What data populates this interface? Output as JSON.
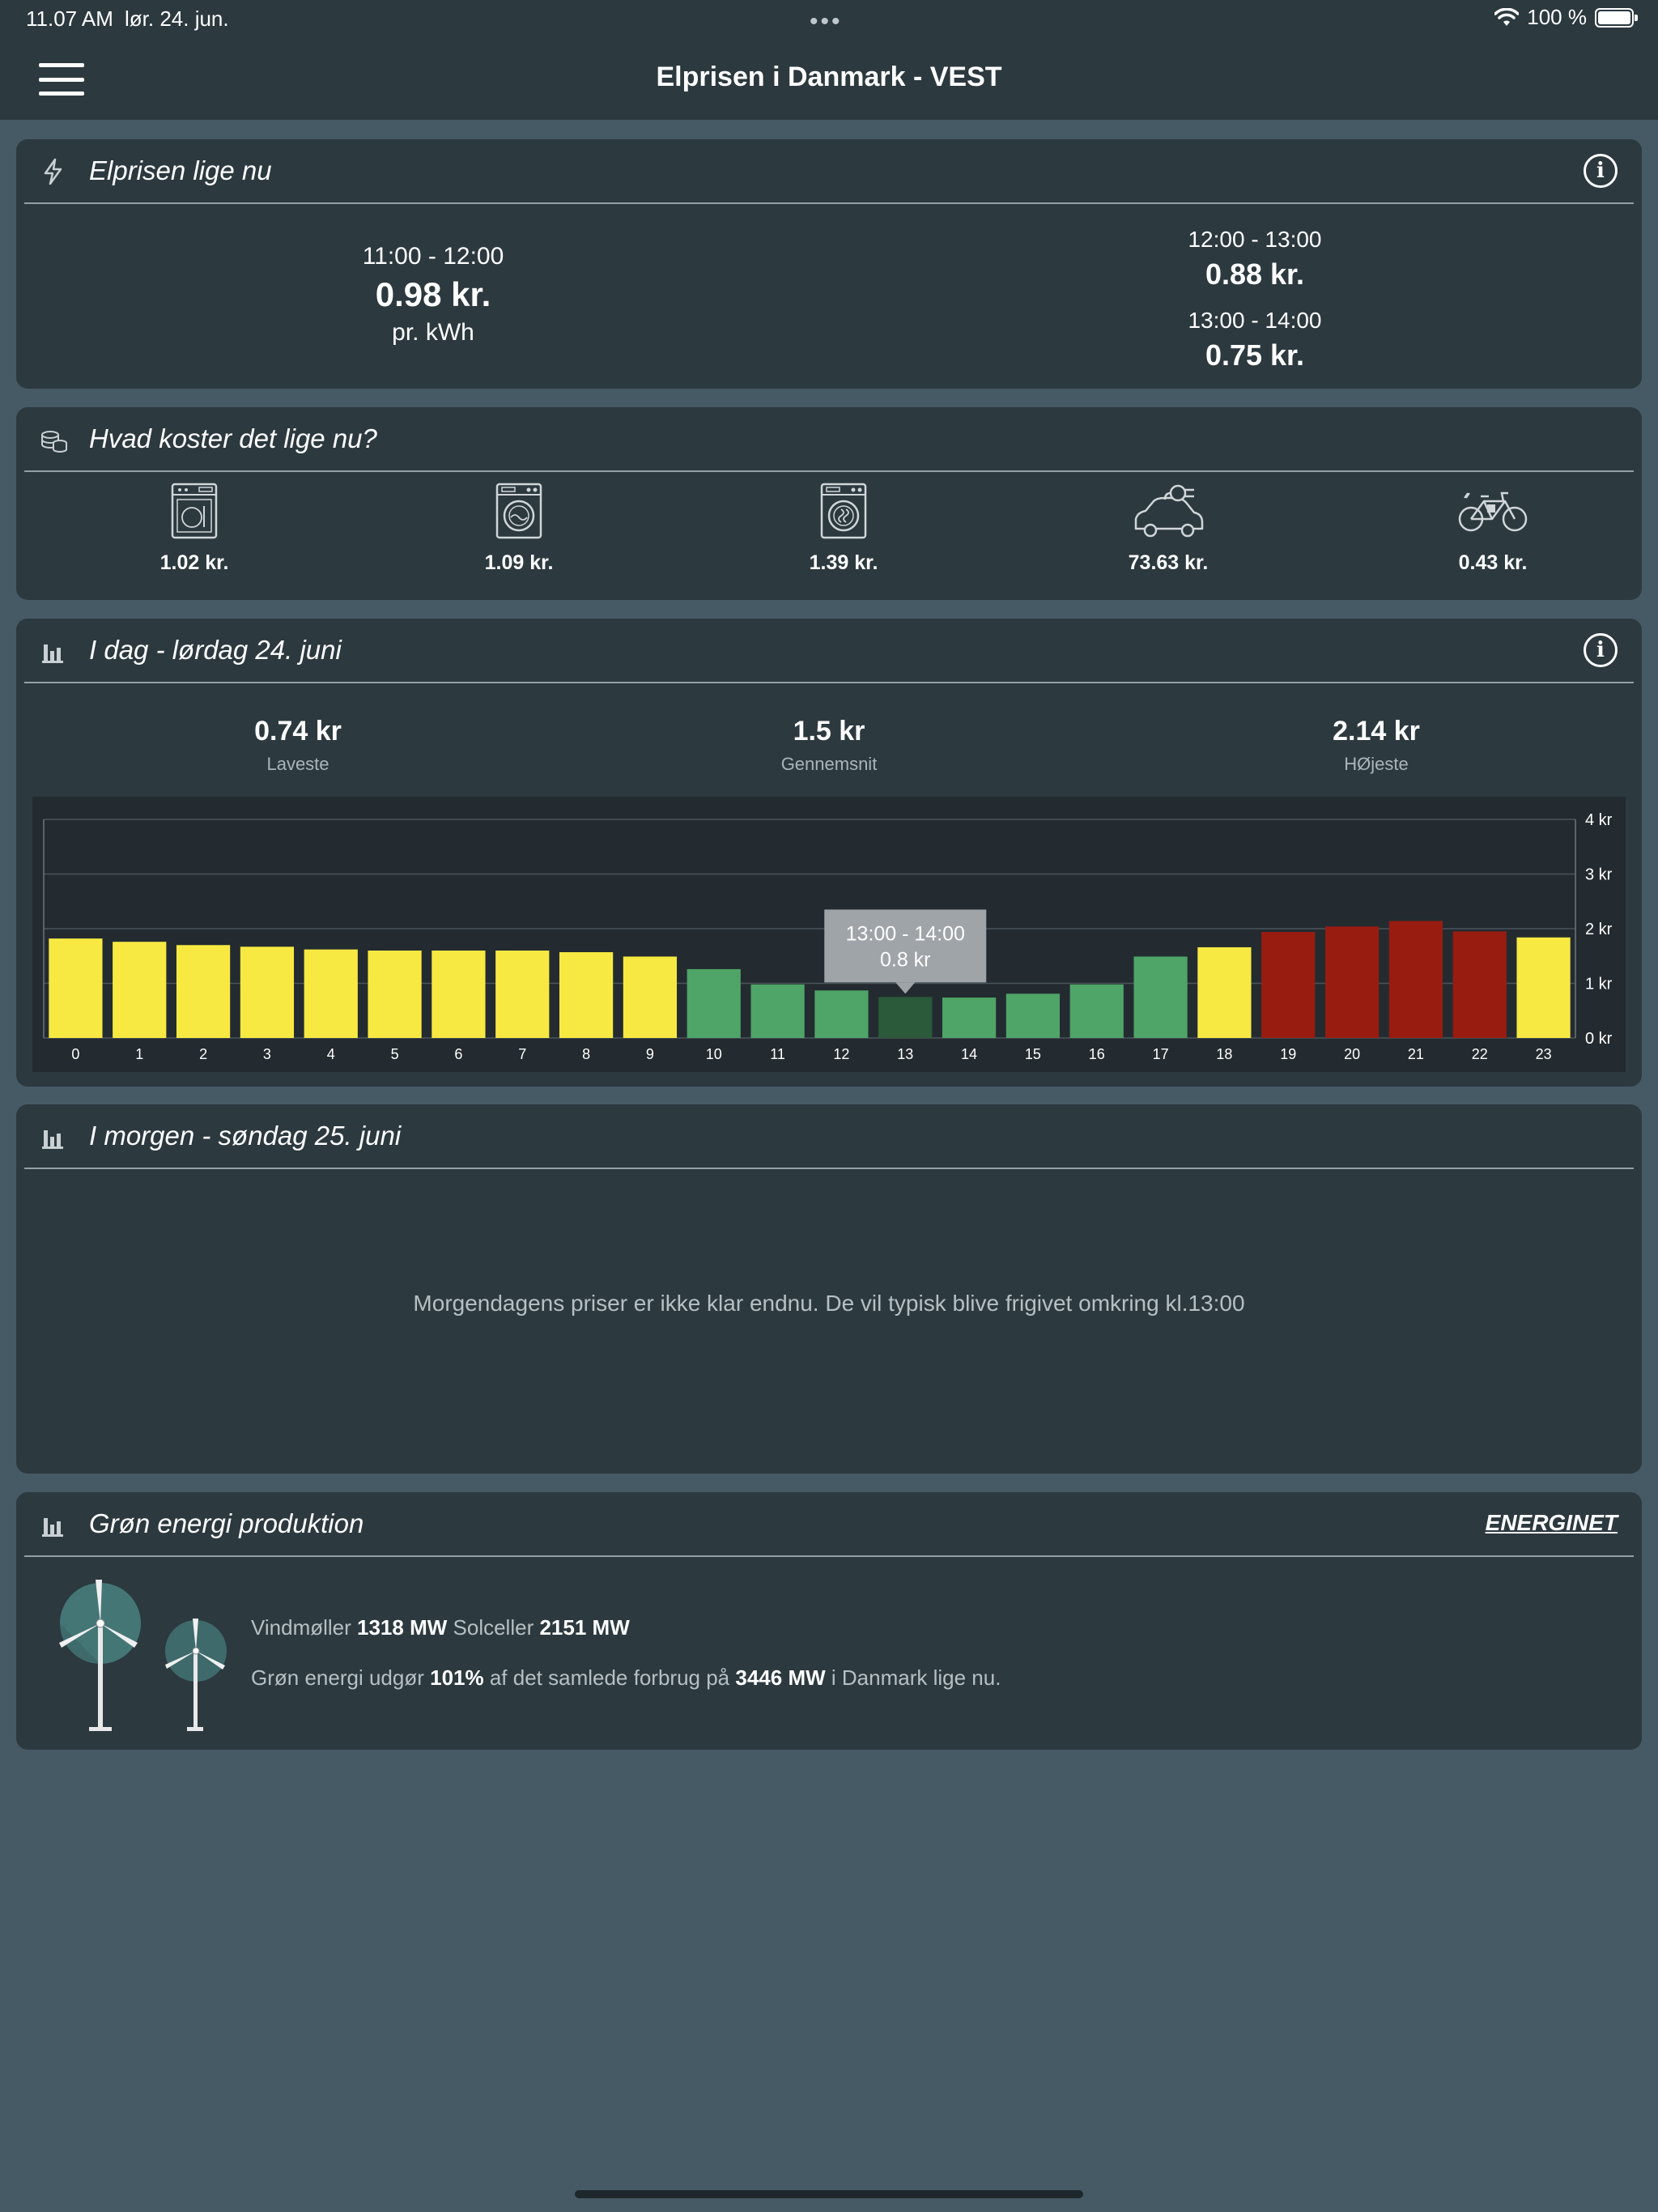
{
  "status_bar": {
    "time": "11.07 AM",
    "date": "lør. 24. jun.",
    "battery": "100 %"
  },
  "header": {
    "title": "Elprisen i Danmark - VEST"
  },
  "price_now": {
    "title": "Elprisen lige nu",
    "current": {
      "range": "11:00 - 12:00",
      "price": "0.98 kr.",
      "unit": "pr. kWh"
    },
    "next": [
      {
        "range": "12:00 - 13:00",
        "price": "0.88 kr."
      },
      {
        "range": "13:00 - 14:00",
        "price": "0.75 kr."
      }
    ]
  },
  "cost_now": {
    "title": "Hvad koster det lige nu?",
    "items": [
      {
        "icon": "dishwasher-icon",
        "price": "1.02 kr."
      },
      {
        "icon": "washing-machine-icon",
        "price": "1.09 kr."
      },
      {
        "icon": "dryer-icon",
        "price": "1.39 kr."
      },
      {
        "icon": "electric-car-icon",
        "price": "73.63 kr."
      },
      {
        "icon": "e-bike-icon",
        "price": "0.43 kr."
      }
    ]
  },
  "today": {
    "title": "I dag - lørdag 24. juni",
    "stats": [
      {
        "value": "0.74 kr",
        "label": "Laveste"
      },
      {
        "value": "1.5 kr",
        "label": "Gennemsnit"
      },
      {
        "value": "2.14 kr",
        "label": "HØjeste"
      }
    ],
    "tooltip": {
      "range": "13:00 - 14:00",
      "value": "0.8 kr"
    }
  },
  "chart_data": {
    "type": "bar",
    "categories": [
      "0",
      "1",
      "2",
      "3",
      "4",
      "5",
      "6",
      "7",
      "8",
      "9",
      "10",
      "11",
      "12",
      "13",
      "14",
      "15",
      "16",
      "17",
      "18",
      "19",
      "20",
      "21",
      "22",
      "23"
    ],
    "values": [
      1.82,
      1.76,
      1.7,
      1.67,
      1.62,
      1.6,
      1.6,
      1.6,
      1.57,
      1.49,
      1.26,
      0.98,
      0.87,
      0.75,
      0.74,
      0.81,
      0.98,
      1.49,
      1.66,
      1.94,
      2.04,
      2.14,
      1.95,
      1.84
    ],
    "colors": [
      "yellow",
      "yellow",
      "yellow",
      "yellow",
      "yellow",
      "yellow",
      "yellow",
      "yellow",
      "yellow",
      "yellow",
      "green",
      "green",
      "green",
      "darkgreen",
      "green",
      "green",
      "green",
      "green",
      "yellow",
      "red",
      "red",
      "red",
      "red",
      "yellow"
    ],
    "palette": {
      "yellow": "#f7e942",
      "green": "#4fa468",
      "darkgreen": "#2a5a39",
      "red": "#981c10"
    },
    "y_ticks": [
      "0 kr",
      "1 kr",
      "2 kr",
      "3 kr",
      "4 kr"
    ],
    "ylim": [
      0,
      4
    ],
    "grid": true,
    "title": "",
    "xlabel": "",
    "ylabel": ""
  },
  "tomorrow": {
    "title": "I morgen - søndag 25. juni",
    "message": "Morgendagens priser er ikke klar endnu. De vil typisk blive frigivet omkring kl.13:00"
  },
  "green": {
    "title": "Grøn energi produktion",
    "link": "ENERGINET",
    "wind_label": "Vindmøller",
    "wind_value": "1318 MW",
    "solar_label": "Solceller",
    "solar_value": "2151 MW",
    "share_prefix": "Grøn energi udgør",
    "share_value": "101%",
    "share_mid": "af det samlede forbrug på",
    "consumption_value": "3446 MW",
    "share_suffix": "i Danmark lige nu."
  }
}
